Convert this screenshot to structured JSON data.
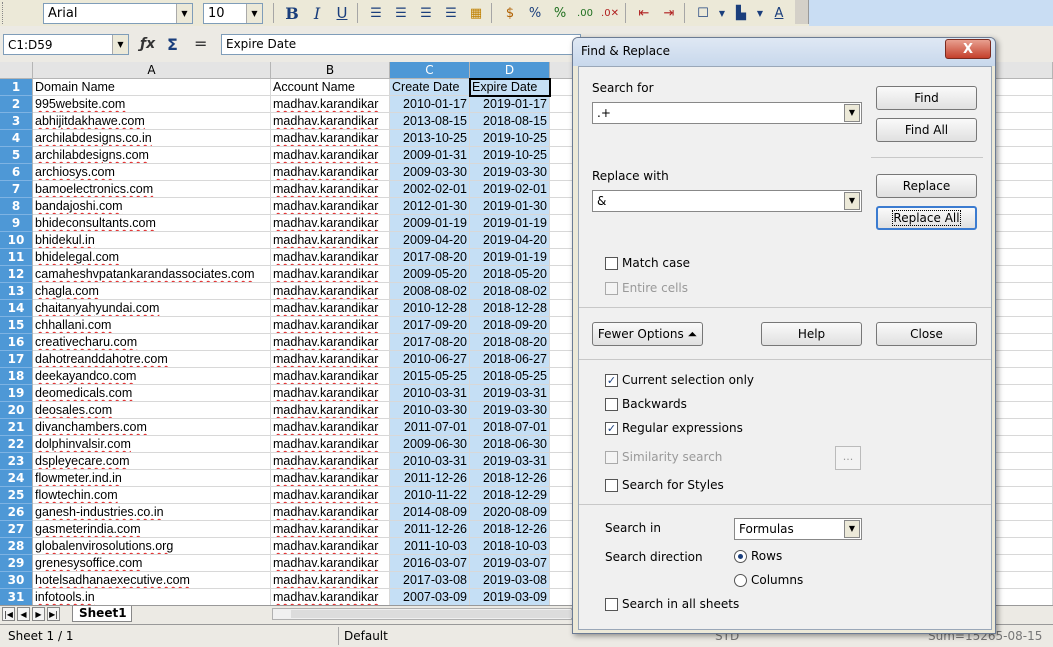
{
  "toolbar": {
    "font_name": "Arial",
    "font_size": "10"
  },
  "formula_bar": {
    "name_box": "C1:D59",
    "content": "Expire Date"
  },
  "columns": [
    "A",
    "B",
    "C",
    "D"
  ],
  "headers": {
    "A": "Domain Name",
    "B": "Account Name",
    "C": "Create Date",
    "D": "Expire Date"
  },
  "rows": [
    {
      "n": "1",
      "a": "Domain Name",
      "b": "Account Name",
      "c": "Create Date",
      "d": "Expire Date"
    },
    {
      "n": "2",
      "a": "995website.com",
      "b": "madhav.karandikar",
      "c": "2010-01-17",
      "d": "2019-01-17"
    },
    {
      "n": "3",
      "a": "abhijitdakhawe.com",
      "b": "madhav.karandikar",
      "c": "2013-08-15",
      "d": "2018-08-15"
    },
    {
      "n": "4",
      "a": "archilabdesigns.co.in",
      "b": "madhav.karandikar",
      "c": "2013-10-25",
      "d": "2019-10-25"
    },
    {
      "n": "5",
      "a": "archilabdesigns.com",
      "b": "madhav.karandikar",
      "c": "2009-01-31",
      "d": "2019-10-25"
    },
    {
      "n": "6",
      "a": "archiosys.com",
      "b": "madhav.karandikar",
      "c": "2009-03-30",
      "d": "2019-03-30"
    },
    {
      "n": "7",
      "a": "bamoelectronics.com",
      "b": "madhav.karandikar",
      "c": "2002-02-01",
      "d": "2019-02-01"
    },
    {
      "n": "8",
      "a": "bandajoshi.com",
      "b": "madhav.karandikar",
      "c": "2012-01-30",
      "d": "2019-01-30"
    },
    {
      "n": "9",
      "a": "bhideconsultants.com",
      "b": "madhav.karandikar",
      "c": "2009-01-19",
      "d": "2019-01-19"
    },
    {
      "n": "10",
      "a": "bhidekul.in",
      "b": "madhav.karandikar",
      "c": "2009-04-20",
      "d": "2019-04-20"
    },
    {
      "n": "11",
      "a": "bhidelegal.com",
      "b": "madhav.karandikar",
      "c": "2017-08-20",
      "d": "2019-01-19"
    },
    {
      "n": "12",
      "a": "camaheshvpatankarandassociates.com",
      "b": "madhav.karandikar",
      "c": "2009-05-20",
      "d": "2018-05-20"
    },
    {
      "n": "13",
      "a": "chagla.com",
      "b": "madhav.karandikar",
      "c": "2008-08-02",
      "d": "2018-08-02"
    },
    {
      "n": "14",
      "a": "chaitanyahyundai.com",
      "b": "madhav.karandikar",
      "c": "2010-12-28",
      "d": "2018-12-28"
    },
    {
      "n": "15",
      "a": "chhallani.com",
      "b": "madhav.karandikar",
      "c": "2017-09-20",
      "d": "2018-09-20"
    },
    {
      "n": "16",
      "a": "creativecharu.com",
      "b": "madhav.karandikar",
      "c": "2017-08-20",
      "d": "2018-08-20"
    },
    {
      "n": "17",
      "a": "dahotreanddahotre.com",
      "b": "madhav.karandikar",
      "c": "2010-06-27",
      "d": "2018-06-27"
    },
    {
      "n": "18",
      "a": "deekayandco.com",
      "b": "madhav.karandikar",
      "c": "2015-05-25",
      "d": "2018-05-25"
    },
    {
      "n": "19",
      "a": "deomedicals.com",
      "b": "madhav.karandikar",
      "c": "2010-03-31",
      "d": "2019-03-31"
    },
    {
      "n": "20",
      "a": "deosales.com",
      "b": "madhav.karandikar",
      "c": "2010-03-30",
      "d": "2019-03-30"
    },
    {
      "n": "21",
      "a": "divanchambers.com",
      "b": "madhav.karandikar",
      "c": "2011-07-01",
      "d": "2018-07-01"
    },
    {
      "n": "22",
      "a": "dolphinvalsir.com",
      "b": "madhav.karandikar",
      "c": "2009-06-30",
      "d": "2018-06-30"
    },
    {
      "n": "23",
      "a": "dspleyecare.com",
      "b": "madhav.karandikar",
      "c": "2010-03-31",
      "d": "2019-03-31"
    },
    {
      "n": "24",
      "a": "flowmeter.ind.in",
      "b": "madhav.karandikar",
      "c": "2011-12-26",
      "d": "2018-12-26"
    },
    {
      "n": "25",
      "a": "flowtechin.com",
      "b": "madhav.karandikar",
      "c": "2010-11-22",
      "d": "2018-12-29"
    },
    {
      "n": "26",
      "a": "ganesh-industries.co.in",
      "b": "madhav.karandikar",
      "c": "2014-08-09",
      "d": "2020-08-09"
    },
    {
      "n": "27",
      "a": "gasmeterindia.com",
      "b": "madhav.karandikar",
      "c": "2011-12-26",
      "d": "2018-12-26"
    },
    {
      "n": "28",
      "a": "globalenvirosolutions.org",
      "b": "madhav.karandikar",
      "c": "2011-10-03",
      "d": "2018-10-03"
    },
    {
      "n": "29",
      "a": "grenesysoffice.com",
      "b": "madhav.karandikar",
      "c": "2016-03-07",
      "d": "2019-03-07"
    },
    {
      "n": "30",
      "a": "hotelsadhanaexecutive.com",
      "b": "madhav.karandikar",
      "c": "2017-03-08",
      "d": "2019-03-08"
    },
    {
      "n": "31",
      "a": "infotools.in",
      "b": "madhav.karandikar",
      "c": "2007-03-09",
      "d": "2019-03-09"
    }
  ],
  "sheet_tabs": {
    "active": "Sheet1"
  },
  "status_bar": {
    "sheet": "Sheet 1 / 1",
    "style": "Default",
    "mode": "STD",
    "sum": "Sum=15265-08-15"
  },
  "dialog": {
    "title": "Find & Replace",
    "close_label": "X",
    "search_for_label": "Search for",
    "search_for_value": ".+",
    "replace_with_label": "Replace with",
    "replace_with_value": "&",
    "find_label": "Find",
    "find_all_label": "Find All",
    "replace_label": "Replace",
    "replace_all_label": "Replace All",
    "match_case_label": "Match case",
    "entire_cells_label": "Entire cells",
    "fewer_options_label": "Fewer Options",
    "help_label": "Help",
    "close_button_label": "Close",
    "current_selection_label": "Current selection only",
    "backwards_label": "Backwards",
    "regex_label": "Regular expressions",
    "similarity_label": "Similarity search",
    "similarity_btn_label": "...",
    "search_styles_label": "Search for Styles",
    "search_in_label": "Search in",
    "search_in_value": "Formulas",
    "search_direction_label": "Search direction",
    "rows_label": "Rows",
    "columns_label": "Columns",
    "all_sheets_label": "Search in all sheets"
  },
  "colors": {
    "selection_header": "#4e98d6",
    "selection_cell": "#c5dff5"
  }
}
